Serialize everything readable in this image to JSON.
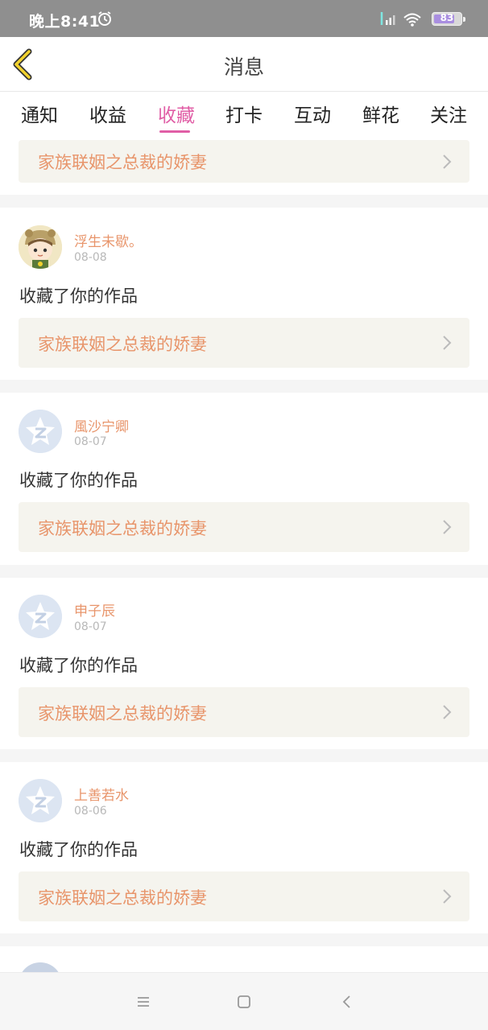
{
  "status_bar": {
    "time": "晚上8:41",
    "battery": "83"
  },
  "header": {
    "title": "消息"
  },
  "tabs": [
    {
      "label": "通知"
    },
    {
      "label": "收益"
    },
    {
      "label": "收藏"
    },
    {
      "label": "打卡"
    },
    {
      "label": "互动"
    },
    {
      "label": "鲜花"
    },
    {
      "label": "关注"
    }
  ],
  "active_tab": "收藏",
  "colors": {
    "accent": "#e05ea6",
    "name": "#e8956b",
    "card_bg": "#f5f4ee"
  },
  "partial_card": {
    "work_title": "家族联姻之总裁的娇妻"
  },
  "items": [
    {
      "user": "浮生未歇。",
      "date": "08-08",
      "action": "收藏了你的作品",
      "work_title": "家族联姻之总裁的娇妻",
      "avatar": "cartoon-avatar"
    },
    {
      "user": "風沙宁卿",
      "date": "08-07",
      "action": "收藏了你的作品",
      "work_title": "家族联姻之总裁的娇妻",
      "avatar": "default-avatar"
    },
    {
      "user": "申子辰",
      "date": "08-07",
      "action": "收藏了你的作品",
      "work_title": "家族联姻之总裁的娇妻",
      "avatar": "default-avatar"
    },
    {
      "user": "上善若水",
      "date": "08-06",
      "action": "收藏了你的作品",
      "work_title": "家族联姻之总裁的娇妻",
      "avatar": "default-avatar"
    }
  ]
}
